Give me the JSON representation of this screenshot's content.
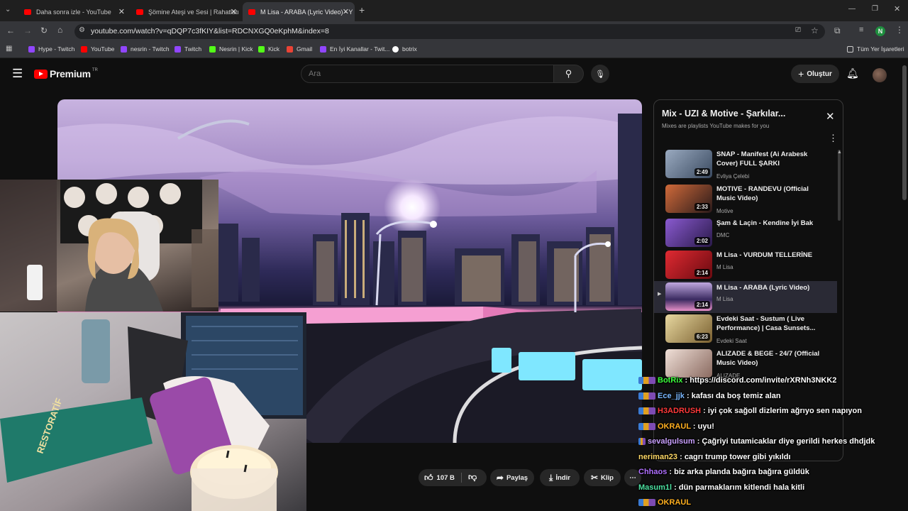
{
  "browser": {
    "tabs": [
      {
        "title": "Daha sonra izle - YouTube"
      },
      {
        "title": "Şömine Ateşi ve Sesi | Rahatlatı"
      },
      {
        "title": "M Lisa - ARABA (Lyric Video) - Y"
      }
    ],
    "url": "youtube.com/watch?v=qDQP7c3fKIY&list=RDCNXGQ0eKphM&index=8",
    "profile_initial": "N",
    "bookmarks": [
      {
        "label": "Hype - Twitch",
        "color": "#9146ff"
      },
      {
        "label": "YouTube",
        "color": "#ff0000"
      },
      {
        "label": "nesrin - Twitch",
        "color": "#9146ff"
      },
      {
        "label": "Twitch",
        "color": "#9146ff"
      },
      {
        "label": "Nesrin | Kick",
        "color": "#53fc18"
      },
      {
        "label": "Kick",
        "color": "#53fc18"
      },
      {
        "label": "Gmail",
        "color": "#ea4335"
      },
      {
        "label": "En İyi Kanallar - Twit...",
        "color": "#9146ff"
      },
      {
        "label": "botrix",
        "color": "#ffffff"
      }
    ],
    "all_bookmarks": "Tüm Yer İşaretleri"
  },
  "youtube": {
    "logo_text": "Premium",
    "logo_region": "TR",
    "search_placeholder": "Ara",
    "create_label": "Oluştur"
  },
  "actions": {
    "likes": "107 B",
    "share": "Paylaş",
    "download": "İndir",
    "clip": "Klip"
  },
  "playlist": {
    "title": "Mix - UZI & Motive - Şarkılar...",
    "subtitle": "Mixes are playlists YouTube makes for you",
    "items": [
      {
        "title": "SNAP - Manifest (Ai Arabesk Cover) FULL ŞARKI",
        "channel": "Evliya Çelebi",
        "duration": "2:49",
        "thumb": "#5a6a80"
      },
      {
        "title": "MOTIVE - RANDEVU (Official Music Video)",
        "channel": "Motive",
        "duration": "2:33",
        "thumb": "#8a3a2a"
      },
      {
        "title": "Şam & Laçin - Kendine İyi Bak",
        "channel": "DMC",
        "duration": "2:02",
        "thumb": "#6a3a9a"
      },
      {
        "title": "M Lisa - VURDUM TELLERİNE",
        "channel": "M Lisa",
        "duration": "2:14",
        "thumb": "#b81a22"
      },
      {
        "title": "M Lisa - ARABA (Lyric Video)",
        "channel": "M Lisa",
        "duration": "2:14",
        "thumb": "#8a6ab8"
      },
      {
        "title": "Evdeki Saat - Sustum ( Live Performance) | Casa Sunsets...",
        "channel": "Evdeki Saat",
        "duration": "6:23",
        "thumb": "#c8b070"
      },
      {
        "title": "ALIZADE & BEGE - 24/7 (Official Music Video)",
        "channel": "ALIZADE",
        "duration": "",
        "thumb": "#d8c8c0"
      }
    ]
  },
  "chat": [
    {
      "user": "BotRix",
      "msg": "https://discord.com/invite/rXRNh3NKK2",
      "color": "#3cff3c"
    },
    {
      "user": "Ece_jjk",
      "msg": "kafası da boş temiz alan",
      "color": "#7ab8ff"
    },
    {
      "user": "H3ADRUSH",
      "msg": "iyi çok sağoll dizlerim ağrıyo sen napıyon",
      "color": "#ff3a3a"
    },
    {
      "user": "OKRAUL",
      "msg": "uyu!",
      "color": "#ffb020"
    },
    {
      "user": "sevalgulsum",
      "msg": "Çağriyi tutamicaklar diye gerildi herkes dhdjdk",
      "color": "#c9a0ff"
    },
    {
      "user": "neriman23",
      "msg": "cagrı trump tower gibi yıkıldı",
      "color": "#ffd966"
    },
    {
      "user": "Chhaos",
      "msg": "biz arka planda bağıra bağıra güldük",
      "color": "#b070ff"
    },
    {
      "user": "Masum1l",
      "msg": "dün parmaklarım kitlendi hala kitli",
      "color": "#4ce0a0"
    },
    {
      "user": "OKRAUL",
      "msg": "",
      "color": "#ffb020"
    }
  ]
}
